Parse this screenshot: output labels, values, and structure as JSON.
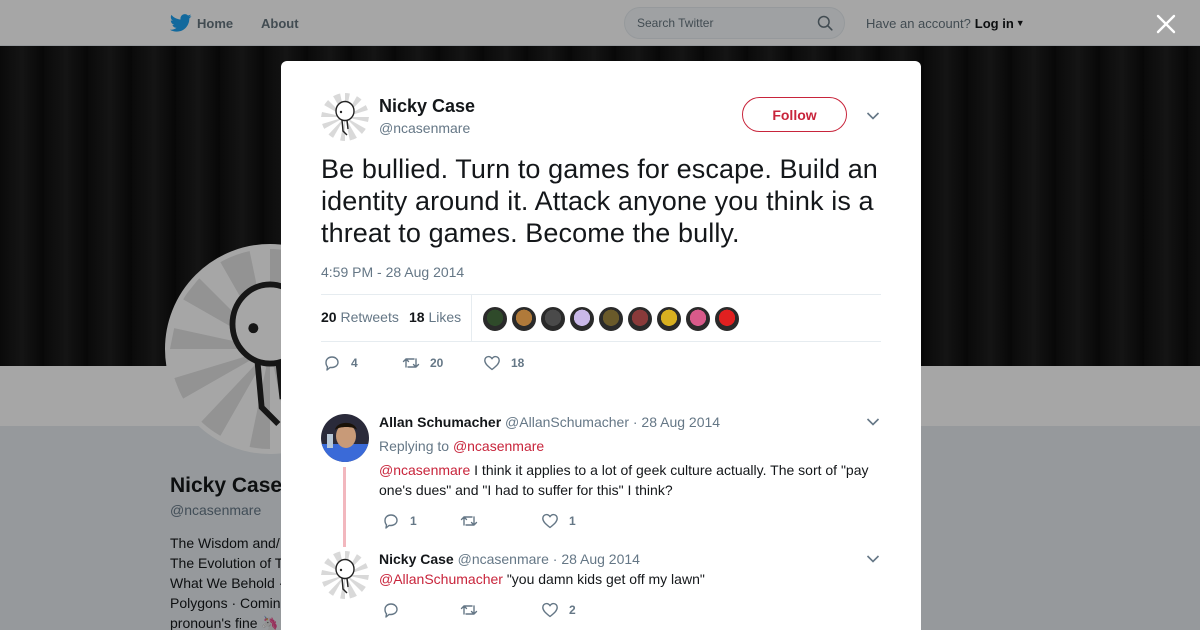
{
  "topbar": {
    "home_label": "Home",
    "about_label": "About",
    "search_placeholder": "Search Twitter",
    "account_prompt": "Have an account?",
    "login_label": "Log in",
    "brand_color": "#1da1f2"
  },
  "profile": {
    "name": "Nicky Case",
    "handle": "@ncasenmare",
    "bio_lines": [
      "The Wisdom and/",
      "The Evolution of T",
      "What We Behold ·",
      "Polygons · Comin",
      "pronoun's fine"
    ]
  },
  "tweet": {
    "author_name": "Nicky Case",
    "author_handle": "@ncasenmare",
    "follow_label": "Follow",
    "text": "Be bullied. Turn to games for escape. Build an identity around it. Attack anyone you think is a threat to games. Become the bully.",
    "timestamp": "4:59 PM - 28 Aug 2014",
    "retweets_count": "20",
    "retweets_label": "Retweets",
    "likes_count": "18",
    "likes_label": "Likes",
    "liker_colors": [
      "#2f4a2a",
      "#b07a3a",
      "#4a4a4a",
      "#c9b8e8",
      "#6a5a2a",
      "#8a3a3a",
      "#d8b020",
      "#d85a8a",
      "#e02020"
    ],
    "actions": {
      "replies": "4",
      "retweets": "20",
      "likes": "18"
    }
  },
  "replies": [
    {
      "name": "Allan Schumacher",
      "handle": "@AllanSchumacher",
      "date": "· 28 Aug 2014",
      "replying_to_label": "Replying to",
      "replying_to": "@ncasenmare",
      "mention": "@ncasenmare",
      "text": " I think it applies to a lot of geek culture actually. The sort of \"pay one's dues\" and \"I had to suffer for this\" I think?",
      "actions": {
        "replies": "1",
        "retweets": "",
        "likes": "1"
      }
    },
    {
      "name": "Nicky Case",
      "handle": "@ncasenmare",
      "date": "· 28 Aug 2014",
      "mention": "@AllanSchumacher",
      "text": " \"you damn kids get off my lawn\"",
      "actions": {
        "replies": "",
        "retweets": "",
        "likes": "2"
      }
    }
  ],
  "colors": {
    "accent": "#c8243b",
    "muted": "#657786",
    "text": "#14171a"
  }
}
